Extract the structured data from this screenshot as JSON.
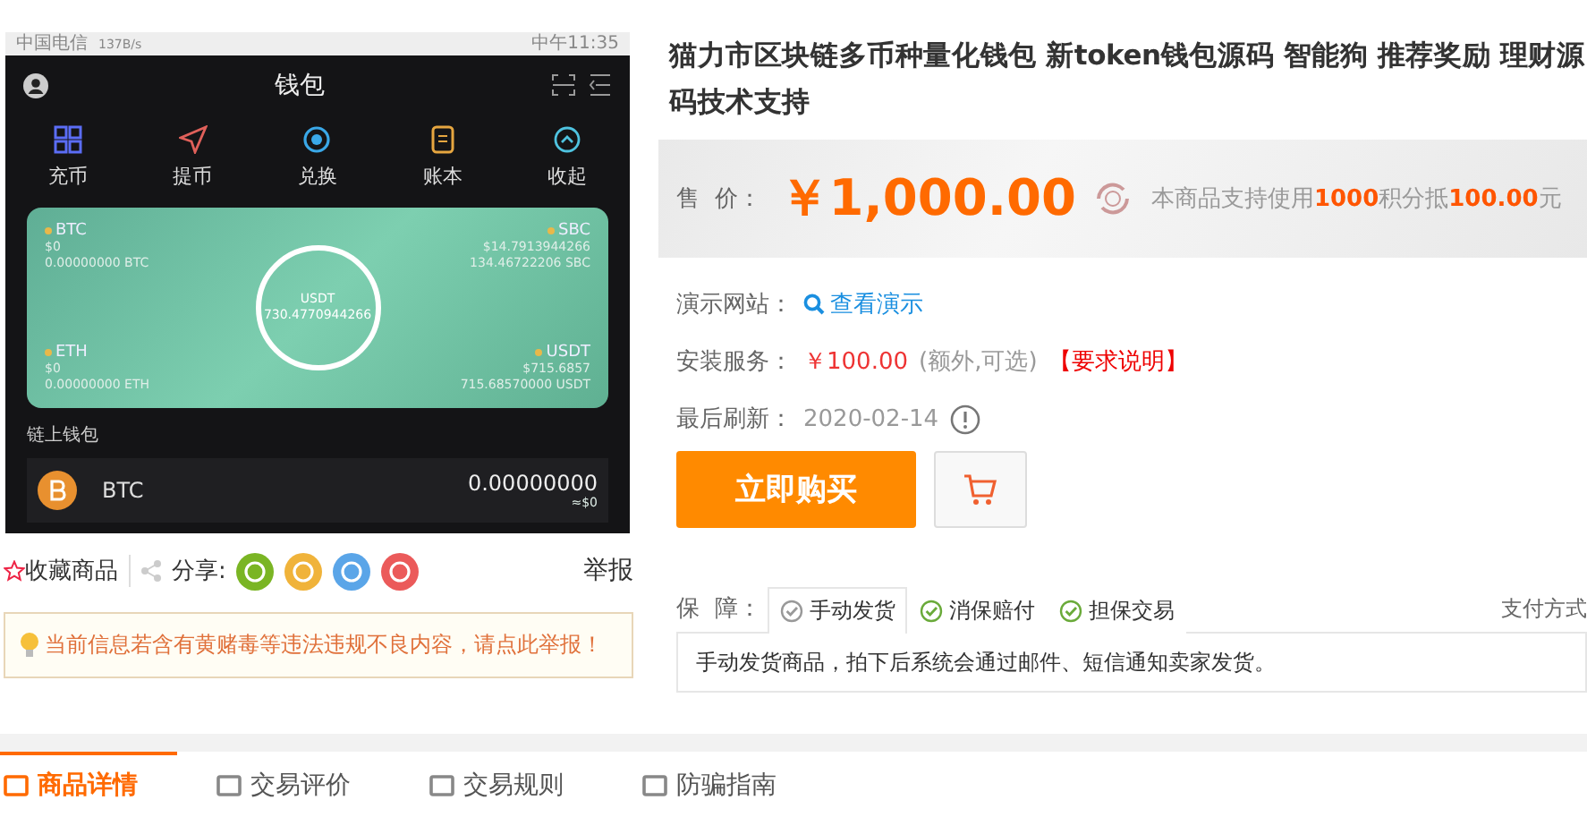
{
  "product_image": {
    "status_bar": {
      "carrier": "中国电信",
      "speed": "137B/s",
      "time": "中午11:35"
    },
    "app_title": "钱包",
    "actions": [
      {
        "label": "充币"
      },
      {
        "label": "提币"
      },
      {
        "label": "兑换"
      },
      {
        "label": "账本"
      },
      {
        "label": "收起"
      }
    ],
    "card": {
      "assets": [
        {
          "symbol": "BTC",
          "usd": "$0",
          "amount": "0.00000000 BTC"
        },
        {
          "symbol": "SBC",
          "usd": "$14.7913944266",
          "amount": "134.46722206 SBC"
        },
        {
          "symbol": "ETH",
          "usd": "$0",
          "amount": "0.00000000 ETH"
        },
        {
          "symbol": "USDT",
          "usd": "$715.6857",
          "amount": "715.68570000 USDT"
        }
      ],
      "total_label": "USDT",
      "total": "730.4770944266"
    },
    "section_label": "链上钱包",
    "coin_row": {
      "symbol": "BTC",
      "amount": "0.00000000",
      "usd": "≈$0"
    }
  },
  "favorite": "收藏商品",
  "share_label": "分享:",
  "report": "举报",
  "notice": "当前信息若含有黄赌毒等违法违规不良内容，请点此举报！",
  "title": "猫力市区块链多币种量化钱包 新token钱包源码 智能狗 推荐奖励 理财源码技术支持",
  "price": {
    "label": "售  价：",
    "value": "￥1,000.00",
    "points_note": "本商品支持使用**1000**积分抵**100.00**元"
  },
  "details": [
    {
      "kind": "link",
      "label": "演示网站：",
      "value": "查看演示"
    },
    {
      "kind": "service",
      "label": "安装服务：",
      "value": "￥100.00",
      "note": "(额外,可选)",
      "link": "【要求说明】"
    },
    {
      "kind": "date",
      "label": "最后刷新：",
      "value": "2020-02-14"
    }
  ],
  "buy_button": "立即购买",
  "guarantee": {
    "label": "保  障：",
    "tabs": [
      {
        "label": "手动发货",
        "selected": true
      },
      {
        "label": "消保赔付",
        "selected": false
      },
      {
        "label": "担保交易",
        "selected": false
      }
    ],
    "description": "手动发货商品，拍下后系统会通过邮件、短信通知卖家发货。",
    "payment": "支付方式"
  },
  "bottom_tabs": [
    {
      "label": "商品详情",
      "selected": true
    },
    {
      "label": "交易评价",
      "selected": false
    },
    {
      "label": "交易规则",
      "selected": false
    },
    {
      "label": "防骗指南",
      "selected": false
    }
  ]
}
